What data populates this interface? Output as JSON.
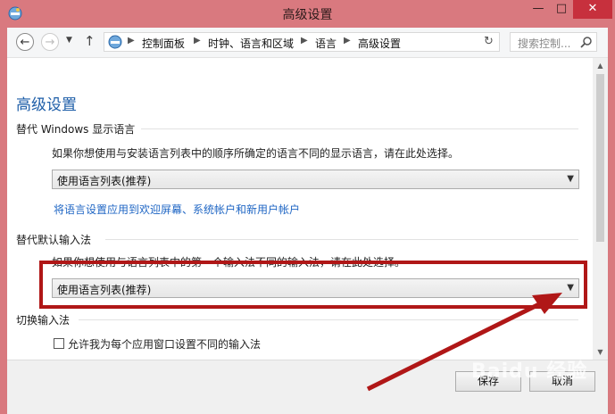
{
  "window": {
    "title": "高级设置",
    "minimize": "—",
    "maximize": "□",
    "close": "✕"
  },
  "address": {
    "crumbs": [
      "控制面板",
      "时钟、语言和区域",
      "语言",
      "高级设置"
    ],
    "separator": "▶",
    "search_placeholder": "搜索控制...",
    "back": "←",
    "forward": "→",
    "history": "▼",
    "up": "↑",
    "refresh": "↻"
  },
  "main": {
    "heading": "高级设置",
    "display_language": {
      "title": "替代 Windows 显示语言",
      "description": "如果你想使用与安装语言列表中的顺序所确定的语言不同的显示语言，请在此处选择。",
      "selected": "使用语言列表(推荐)",
      "link": "将语言设置应用到欢迎屏幕、系统帐户和新用户帐户"
    },
    "input_method": {
      "title": "替代默认输入法",
      "description": "如果你想使用与语言列表中的第一个输入法不同的输入法，请在此处选择。",
      "selected": "使用语言列表(推荐)"
    },
    "switch_input": {
      "title": "切换输入法",
      "checkbox_label": "允许我为每个应用窗口设置不同的输入法",
      "checked": false
    }
  },
  "footer": {
    "save": "保存",
    "cancel": "取消"
  },
  "watermark": "Baidu 经验",
  "colors": {
    "titlebar": "#d9797f",
    "close": "#c7303d",
    "accent": "#1e5ea8",
    "link": "#1f66c4",
    "annotation": "#b01717"
  },
  "icons": {
    "back": "back-arrow-icon",
    "forward": "forward-arrow-icon",
    "up": "up-arrow-icon",
    "refresh": "refresh-icon",
    "search": "search-icon",
    "app": "control-panel-icon",
    "dropdown": "chevron-down-icon"
  }
}
